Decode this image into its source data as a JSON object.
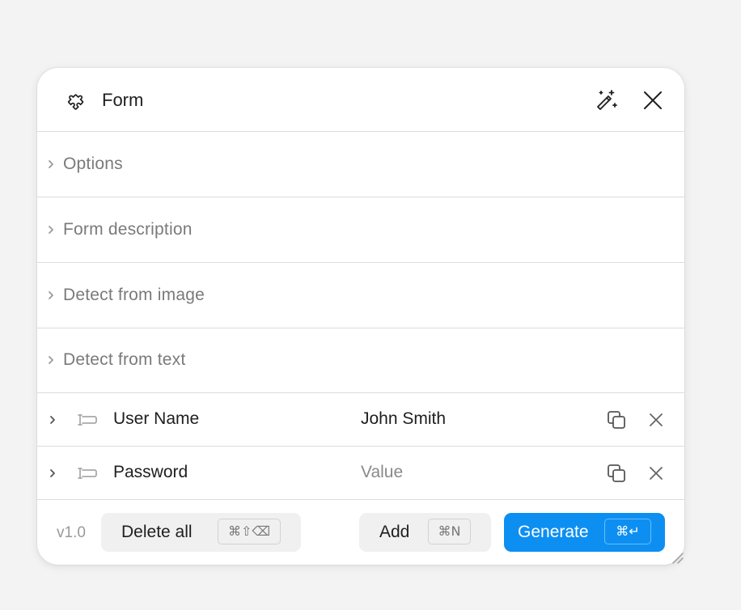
{
  "header": {
    "title": "Form",
    "plugin_icon": "puzzle-icon",
    "magic_icon": "magic-wand-icon",
    "close_icon": "close-icon"
  },
  "sections": [
    {
      "label": "Options"
    },
    {
      "label": "Form description"
    },
    {
      "label": "Detect from image"
    },
    {
      "label": "Detect from text"
    }
  ],
  "fields": [
    {
      "name": "User Name",
      "value": "John Smith",
      "placeholder": "Value"
    },
    {
      "name": "Password",
      "value": "",
      "placeholder": "Value"
    }
  ],
  "footer": {
    "version": "v1.0",
    "delete_label": "Delete all",
    "delete_shortcut": "⌘⇧⌫",
    "add_label": "Add",
    "add_shortcut": "⌘N",
    "generate_label": "Generate",
    "generate_shortcut": "⌘↵"
  },
  "colors": {
    "accent": "#0d8ff2",
    "background": "#f3f3f3",
    "panel": "#ffffff",
    "muted_text": "#7a7a7a"
  }
}
